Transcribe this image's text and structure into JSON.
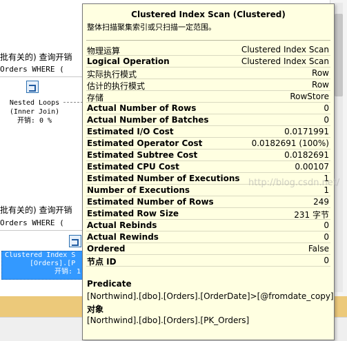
{
  "background": {
    "query1_text": "批有关的) 查询开销",
    "query1_sql": "Orders WHERE (",
    "nested_loops": {
      "name": "Nested Loops",
      "kind": "(Inner Join)",
      "cost": "开销: 0 %"
    },
    "query2_text": "批有关的) 查询开销",
    "query2_sql": "Orders WHERE (",
    "selected_op": {
      "line1": "Clustered Index S",
      "line2": "[Orders].[P",
      "line3": "开销: 1"
    }
  },
  "tooltip": {
    "title": "Clustered Index Scan (Clustered)",
    "subtitle": "整体扫描聚集索引或只扫描一定范围。",
    "rows": [
      {
        "label": "物理运算",
        "value": "Clustered Index Scan",
        "bold": false
      },
      {
        "label": "Logical Operation",
        "value": "Clustered Index Scan",
        "bold": true
      },
      {
        "label": "实际执行模式",
        "value": "Row",
        "bold": false
      },
      {
        "label": "估计的执行模式",
        "value": "Row",
        "bold": false
      },
      {
        "label": "存储",
        "value": "RowStore",
        "bold": false
      },
      {
        "label": "Actual Number of Rows",
        "value": "0",
        "bold": true
      },
      {
        "label": "Actual Number of Batches",
        "value": "0",
        "bold": true
      },
      {
        "label": "Estimated I/O Cost",
        "value": "0.0171991",
        "bold": true
      },
      {
        "label": "Estimated Operator Cost",
        "value": "0.0182691 (100%)",
        "bold": true
      },
      {
        "label": "Estimated Subtree Cost",
        "value": "0.0182691",
        "bold": true
      },
      {
        "label": "Estimated CPU Cost",
        "value": "0.00107",
        "bold": true
      },
      {
        "label": "Estimated Number of Executions",
        "value": "1",
        "bold": true
      },
      {
        "label": "Number of Executions",
        "value": "1",
        "bold": true
      },
      {
        "label": "Estimated Number of Rows",
        "value": "249",
        "bold": true
      },
      {
        "label": "Estimated Row Size",
        "value": "231 字节",
        "bold": true
      },
      {
        "label": "Actual Rebinds",
        "value": "0",
        "bold": true
      },
      {
        "label": "Actual Rewinds",
        "value": "0",
        "bold": true
      },
      {
        "label": "Ordered",
        "value": "False",
        "bold": true
      },
      {
        "label": "节点 ID",
        "value": "0",
        "bold": true
      }
    ],
    "predicate_label": "Predicate",
    "predicate_value": "[Northwind].[dbo].[Orders].[OrderDate]>[@fromdate_copy]",
    "object_label": "对象",
    "object_value": "[Northwind].[dbo].[Orders].[PK_Orders]",
    "watermark": "http://blog.csdn.net/"
  },
  "colors": {
    "tooltip_bg": "#ffffe1",
    "selection": "#3399ff",
    "bottom_bar": "#ecc97a"
  }
}
